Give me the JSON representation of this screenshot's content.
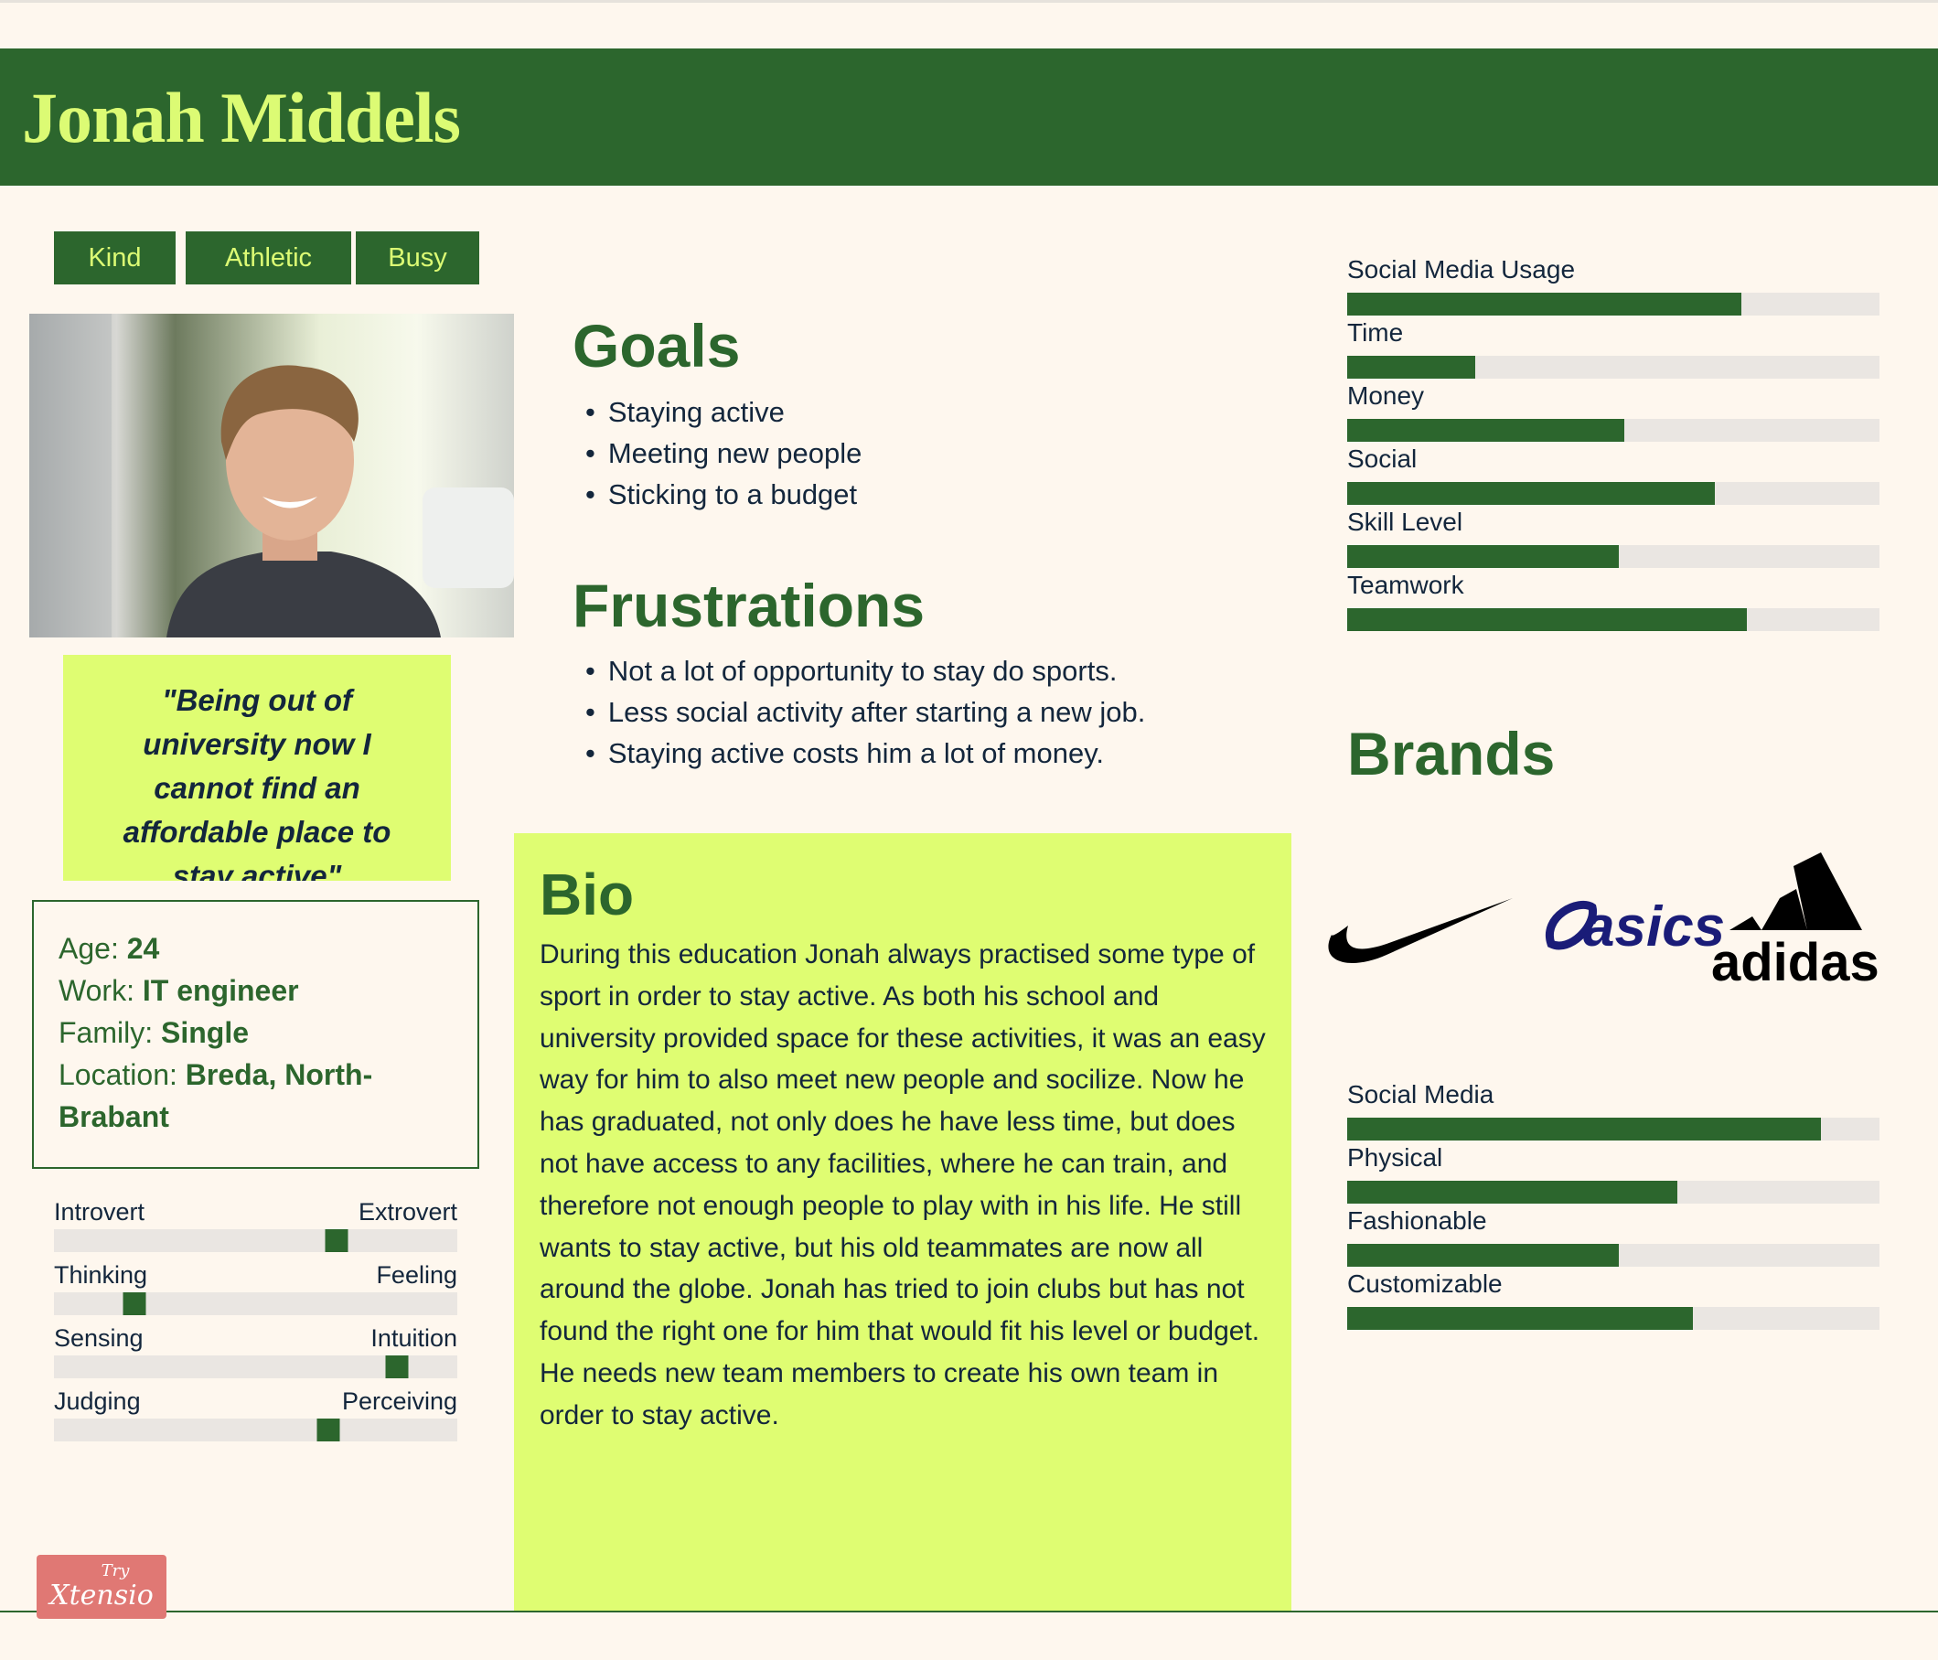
{
  "persona": {
    "name": "Jonah Middels",
    "tags": [
      "Kind",
      "Athletic",
      "Busy"
    ],
    "quote": "\"Being out of university now I cannot find an affordable place to stay active\"",
    "info": [
      {
        "label": "Age:",
        "value": "24"
      },
      {
        "label": "Work:",
        "value": "IT engineer"
      },
      {
        "label": "Family:",
        "value": "Single"
      },
      {
        "label": "Location:",
        "value": "Breda, North-Brabant"
      }
    ]
  },
  "personality": [
    {
      "left": "Introvert",
      "right": "Extrovert",
      "value": 0.7
    },
    {
      "left": "Thinking",
      "right": "Feeling",
      "value": 0.2
    },
    {
      "left": "Sensing",
      "right": "Intuition",
      "value": 0.85
    },
    {
      "left": "Judging",
      "right": "Perceiving",
      "value": 0.68
    }
  ],
  "goals": {
    "title": "Goals",
    "items": [
      "Staying active",
      "Meeting new people",
      "Sticking to a budget"
    ]
  },
  "frustrations": {
    "title": "Frustrations",
    "items": [
      "Not a lot of opportunity to stay do sports.",
      "Less social activity after starting a new job.",
      "Staying active costs him a lot of money."
    ]
  },
  "bio": {
    "title": "Bio",
    "text": "During this education Jonah always practised some type of sport in order to stay active. As both his school and university provided space for these activities, it was an easy way for him to also meet new people and socilize.  Now he has graduated, not only does he have less time, but does not have access to any facilities, where he can train, and therefore not enough people to play with in his life. He still wants to stay active, but his old teammates are now all around the globe. Jonah has tried to join clubs but has not found the right one for him that would fit his level or budget. He needs new team members to create his own team in order to stay active."
  },
  "motivations": [
    {
      "label": "Social Media Usage",
      "value": 0.74
    },
    {
      "label": "Time",
      "value": 0.24
    },
    {
      "label": "Money",
      "value": 0.52
    },
    {
      "label": "Social",
      "value": 0.69
    },
    {
      "label": "Skill Level",
      "value": 0.51
    },
    {
      "label": "Teamwork",
      "value": 0.75
    }
  ],
  "brands": {
    "title": "Brands",
    "logos": [
      "Nike",
      "asics",
      "adidas"
    ]
  },
  "preferences": [
    {
      "label": "Social Media",
      "value": 0.89
    },
    {
      "label": "Physical",
      "value": 0.62
    },
    {
      "label": "Fashionable",
      "value": 0.51
    },
    {
      "label": "Customizable",
      "value": 0.65
    }
  ],
  "footer": {
    "try": "Try",
    "brand": "Xtensio"
  },
  "colors": {
    "green": "#2c662d",
    "lime": "#dffd72",
    "bg": "#fef7ee"
  }
}
